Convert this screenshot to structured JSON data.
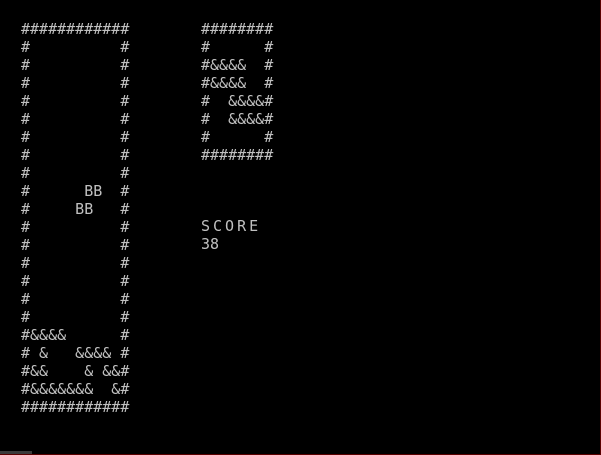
{
  "game": {
    "board_rows": [
      "############",
      "#          #",
      "#          #",
      "#          #",
      "#          #",
      "#          #",
      "#          #",
      "#          #",
      "#          #",
      "#      BB  #",
      "#     BB   #",
      "#          #",
      "#          #",
      "#          #",
      "#          #",
      "#          #",
      "#          #",
      "#&&&&      #",
      "# &   &&&& #",
      "#&&    & &&#",
      "#&&&&&&&  &#",
      "############"
    ],
    "preview_rows": [
      "########",
      "#      #",
      "#&&&&  #",
      "#&&&&  #",
      "#  &&&&#",
      "#  &&&&#",
      "#      #",
      "########"
    ],
    "score_label": "SCORE",
    "score_value": "38"
  },
  "colors": {
    "background": "#000000",
    "text": "#c0c0c0"
  }
}
